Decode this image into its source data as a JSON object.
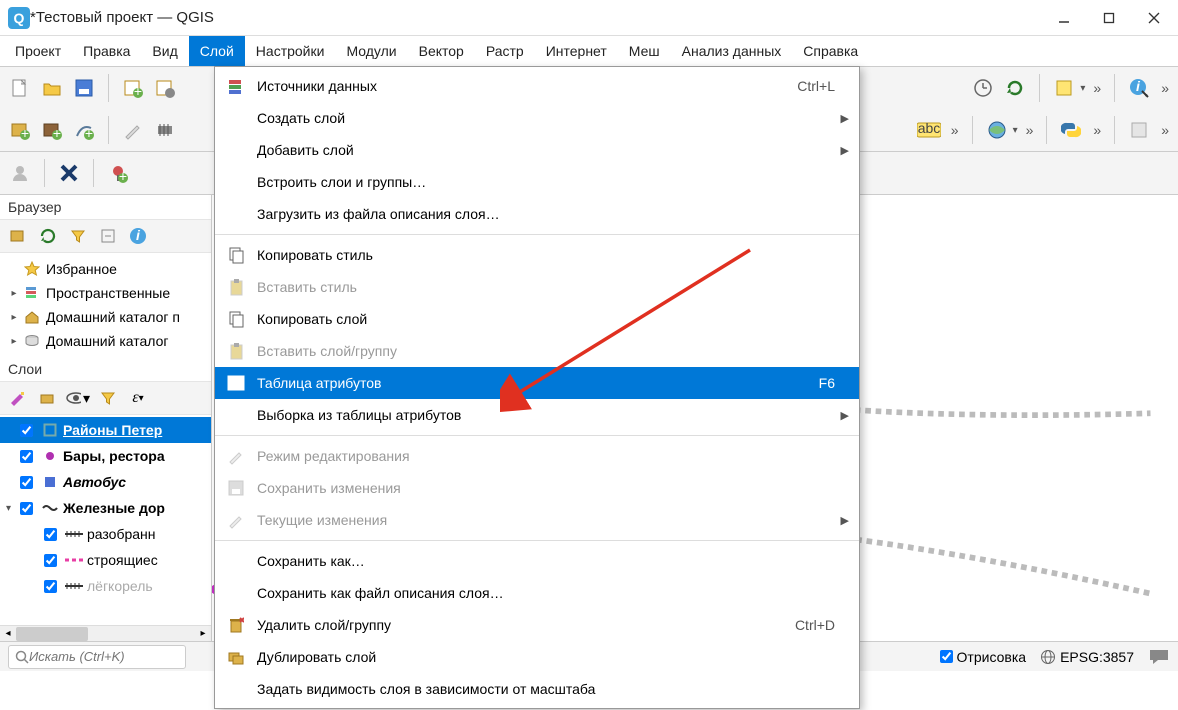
{
  "title": "*Тестовый проект — QGIS",
  "menubar": [
    "Проект",
    "Правка",
    "Вид",
    "Слой",
    "Настройки",
    "Модули",
    "Вектор",
    "Растр",
    "Интернет",
    "Меш",
    "Анализ данных",
    "Справка"
  ],
  "dropdown": {
    "items": [
      {
        "label": "Источники данных",
        "shortcut": "Ctrl+L",
        "icon": "layers-icon"
      },
      {
        "label": "Создать слой",
        "submenu": true
      },
      {
        "label": "Добавить слой",
        "submenu": true
      },
      {
        "label": "Встроить слои и группы…"
      },
      {
        "label": "Загрузить из файла описания слоя…"
      },
      {
        "sep": true
      },
      {
        "label": "Копировать стиль",
        "icon": "copy-icon"
      },
      {
        "label": "Вставить стиль",
        "icon": "paste-icon",
        "disabled": true
      },
      {
        "label": "Копировать слой",
        "icon": "copy-icon"
      },
      {
        "label": "Вставить слой/группу",
        "icon": "paste-icon",
        "disabled": true
      },
      {
        "label": "Таблица атрибутов",
        "icon": "table-icon",
        "shortcut": "F6",
        "highlight": true
      },
      {
        "label": "Выборка из таблицы атрибутов",
        "submenu": true
      },
      {
        "sep": true
      },
      {
        "label": "Режим редактирования",
        "icon": "pencil-icon",
        "disabled": true
      },
      {
        "label": "Сохранить изменения",
        "icon": "save-icon",
        "disabled": true
      },
      {
        "label": "Текущие изменения",
        "icon": "pencil-icon",
        "disabled": true,
        "submenu": true
      },
      {
        "sep": true
      },
      {
        "label": "Сохранить как…"
      },
      {
        "label": "Сохранить как файл описания слоя…"
      },
      {
        "label": "Удалить слой/группу",
        "icon": "delete-icon",
        "shortcut": "Ctrl+D"
      },
      {
        "label": "Дублировать слой",
        "icon": "duplicate-icon"
      },
      {
        "label": "Задать видимость слоя в зависимости от масштаба"
      }
    ]
  },
  "browser": {
    "title": "Браузер",
    "items": [
      {
        "label": "Избранное",
        "icon": "star"
      },
      {
        "label": "Пространственные",
        "icon": "bookmark",
        "expand": true
      },
      {
        "label": "Домашний каталог п",
        "icon": "home",
        "expand": true
      },
      {
        "label": "Домашний каталог",
        "icon": "drive",
        "expand": true
      }
    ]
  },
  "layers": {
    "title": "Слои",
    "items": [
      {
        "label": "Районы Петер",
        "selected": true,
        "symbol": "square-outline",
        "color": "#7aa"
      },
      {
        "label": "Бары, рестора",
        "bold": true,
        "symbol": "dot",
        "color": "#b030b0"
      },
      {
        "label": "Автобус",
        "italic": true,
        "symbol": "square",
        "color": "#4a6fd4"
      },
      {
        "label": "Железные дор",
        "bold": true,
        "expand": true,
        "symbol": "wave",
        "children": [
          {
            "label": "разобранн",
            "symbol": "rail"
          },
          {
            "label": "строящиес",
            "symbol": "dash",
            "color": "#e83ea5"
          },
          {
            "label": "лёгкорель",
            "symbol": "rail",
            "disabled": true
          }
        ]
      }
    ]
  },
  "search_placeholder": "Искать (Ctrl+K)",
  "status": {
    "render_label": "Отрисовка",
    "epsg": "EPSG:3857"
  }
}
